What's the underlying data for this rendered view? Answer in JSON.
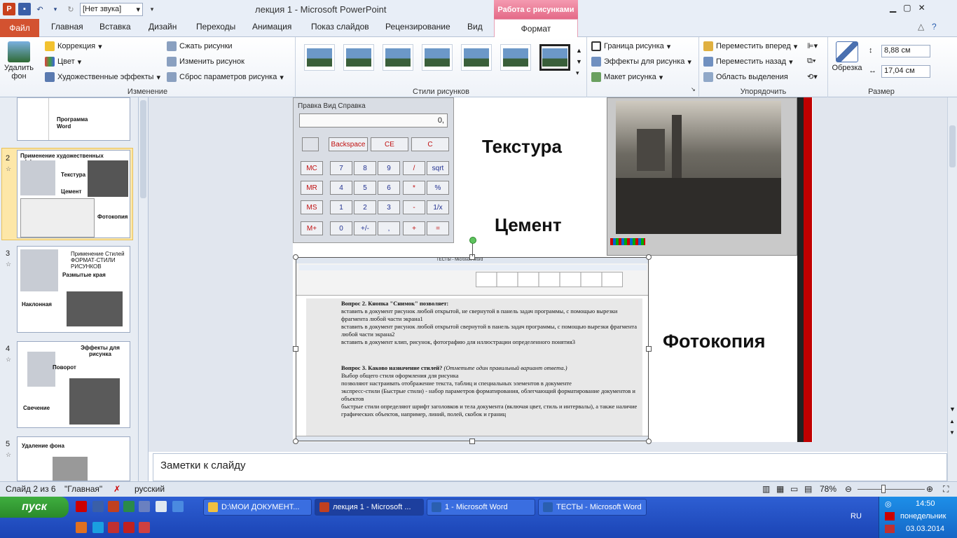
{
  "window": {
    "title": "лекция 1  -  Microsoft PowerPoint",
    "context_tab_header": "Работа с рисунками",
    "sound_combo": "[Нет звука]"
  },
  "tabs": {
    "file": "Файл",
    "items": [
      "Главная",
      "Вставка",
      "Дизайн",
      "Переходы",
      "Анимация",
      "Показ слайдов",
      "Рецензирование",
      "Вид"
    ],
    "format": "Формат"
  },
  "ribbon": {
    "remove_bg": "Удалить фон",
    "change": {
      "label": "Изменение",
      "correction": "Коррекция",
      "color": "Цвет",
      "art_effects": "Художественные эффекты",
      "compress": "Сжать рисунки",
      "change_pic": "Изменить рисунок",
      "reset": "Сброс параметров рисунка"
    },
    "styles": {
      "label": "Стили рисунков",
      "border": "Граница рисунка",
      "effects": "Эффекты для рисунка",
      "layout": "Макет рисунка"
    },
    "arrange": {
      "label": "Упорядочить",
      "forward": "Переместить вперед",
      "backward": "Переместить назад",
      "selection": "Область выделения"
    },
    "size": {
      "label": "Размер",
      "crop": "Обрезка",
      "height": "8,88 см",
      "width": "17,04 см"
    }
  },
  "slides_panel": {
    "slides": [
      {
        "num": "2",
        "title": "Применение художественных эффектов",
        "l1": "Текстура",
        "l2": "Цемент",
        "l3": "Фотокопия"
      },
      {
        "num": "3",
        "title": "Применение Стилей ФОРМАТ-СТИЛИ РИСУНКОВ",
        "l1": "Размытые края",
        "l2": "Наклонная"
      },
      {
        "num": "4",
        "title": "Эффекты для рисунка",
        "l1": "Поворот",
        "l2": "Свечение"
      },
      {
        "num": "5",
        "title": "Удаление фона"
      }
    ],
    "slide1_heading": "Программа",
    "slide1_word": "Word"
  },
  "slide": {
    "texture": "Текстура",
    "cement": "Цемент",
    "photocopy": "Фотокопия",
    "calc": {
      "menu": "Правка   Вид   Справка",
      "display": "0,",
      "buttons": [
        "Backspace",
        "CE",
        "C",
        "MC",
        "7",
        "8",
        "9",
        "/",
        "sqrt",
        "MR",
        "4",
        "5",
        "6",
        "*",
        "%",
        "MS",
        "1",
        "2",
        "3",
        "-",
        "1/x",
        "M+",
        "0",
        "+/-",
        ",",
        "+",
        "="
      ]
    },
    "word": {
      "title": "ТЕСТЫ - Microsoft Word",
      "q2_title": "Вопрос 2. Кнопка \"Снимок\" позволяет:",
      "q2_a1": "вставить в документ рисунок любой открытой, не свернутой в панель задач программы, с помощью вырезки фрагмента любой части экрана1",
      "q2_a2": "вставить в документ рисунок любой открытой свернутой в панель задач программы, с помощью вырезки фрагмента любой части экрана2",
      "q2_a3": "вставить в документ клип, рисунок, фотографию для иллюстрации определенного понятия3",
      "q3_title": "Вопрос 3. Каково назначение стилей?",
      "q3_hint": "(Отметьте один правильный вариант ответа.)",
      "q3_a1": "Выбор общего стиля оформления для рисунка",
      "q3_a2": "позволяют настраивать отображение текста, таблиц и специальных элементов в документе",
      "q3_a3": "экспресс-стили (Быстрые стили) - набор параметров форматирования, облегчающий форматирование документов и объектов",
      "q3_a4": "быстрые стили определяют шрифт заголовков и тела документа (включая цвет, стиль и интервалы), а также наличие графических объектов, например, линий, полей, скобок и границ"
    }
  },
  "notes": "Заметки к слайду",
  "status": {
    "slide": "Слайд 2 из 6",
    "theme": "\"Главная\"",
    "lang": "русский",
    "zoom": "78%"
  },
  "taskbar": {
    "start": "пуск",
    "tasks": [
      "D:\\МОИ ДОКУМЕНТ...",
      "лекция 1 - Microsoft ...",
      "1 - Microsoft Word",
      "ТЕСТЫ - Microsoft Word"
    ],
    "lang": "RU",
    "time": "14:50",
    "day": "понедельник",
    "date": "03.03.2014"
  },
  "colors": {
    "file_tab": "#d35230",
    "context": "#e46a88",
    "selected_slide": "#fde7a8"
  }
}
